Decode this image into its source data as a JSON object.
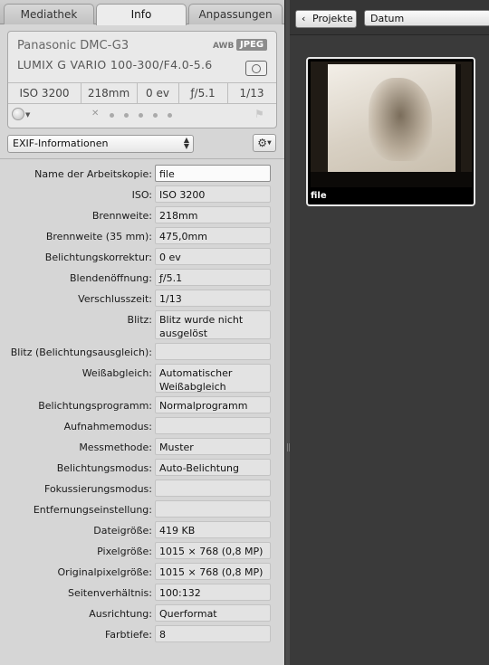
{
  "tabs": [
    {
      "label": "Mediathek"
    },
    {
      "label": "Info"
    },
    {
      "label": "Anpassungen"
    }
  ],
  "camera": {
    "model": "Panasonic DMC-G3",
    "lens": "LUMIX G VARIO 100-300/F4.0-5.6",
    "awb": "AWB",
    "format": "JPEG"
  },
  "exposure": {
    "iso": "ISO 3200",
    "focal": "218mm",
    "ev": "0 ev",
    "aperture": "ƒ/5.1",
    "shutter": "1/13"
  },
  "rating": {
    "stars": 0,
    "max": 5
  },
  "metadata_view": {
    "selected": "EXIF-Informationen"
  },
  "metadata": [
    {
      "label": "Name der Arbeitskopie:",
      "value": "file"
    },
    {
      "label": "ISO:",
      "value": "ISO 3200"
    },
    {
      "label": "Brennweite:",
      "value": "218mm"
    },
    {
      "label": "Brennweite (35 mm):",
      "value": "475,0mm"
    },
    {
      "label": "Belichtungskorrektur:",
      "value": "0 ev"
    },
    {
      "label": "Blendenöffnung:",
      "value": "ƒ/5.1"
    },
    {
      "label": "Verschlusszeit:",
      "value": "1/13"
    },
    {
      "label": "Blitz:",
      "value": "Blitz wurde nicht\nausgelöst"
    },
    {
      "label": "Blitz (Belichtungsausgleich):",
      "value": ""
    },
    {
      "label": "Weißabgleich:",
      "value": "Automatischer\nWeißabgleich"
    },
    {
      "label": "Belichtungsprogramm:",
      "value": "Normalprogramm"
    },
    {
      "label": "Aufnahmemodus:",
      "value": ""
    },
    {
      "label": "Messmethode:",
      "value": "Muster"
    },
    {
      "label": "Belichtungsmodus:",
      "value": "Auto-Belichtung"
    },
    {
      "label": "Fokussierungsmodus:",
      "value": ""
    },
    {
      "label": "Entfernungseinstellung:",
      "value": ""
    },
    {
      "label": "Dateigröße:",
      "value": "419 KB"
    },
    {
      "label": "Pixelgröße:",
      "value": "1015 × 768 (0,8 MP)"
    },
    {
      "label": "Originalpixelgröße:",
      "value": "1015 × 768 (0,8 MP)"
    },
    {
      "label": "Seitenverhältnis:",
      "value": "100:132"
    },
    {
      "label": "Ausrichtung:",
      "value": "Querformat"
    },
    {
      "label": "Farbtiefe:",
      "value": "8"
    }
  ],
  "browser": {
    "back_label": "Projekte",
    "sort_label": "Datum",
    "thumbnail_caption": "file"
  }
}
